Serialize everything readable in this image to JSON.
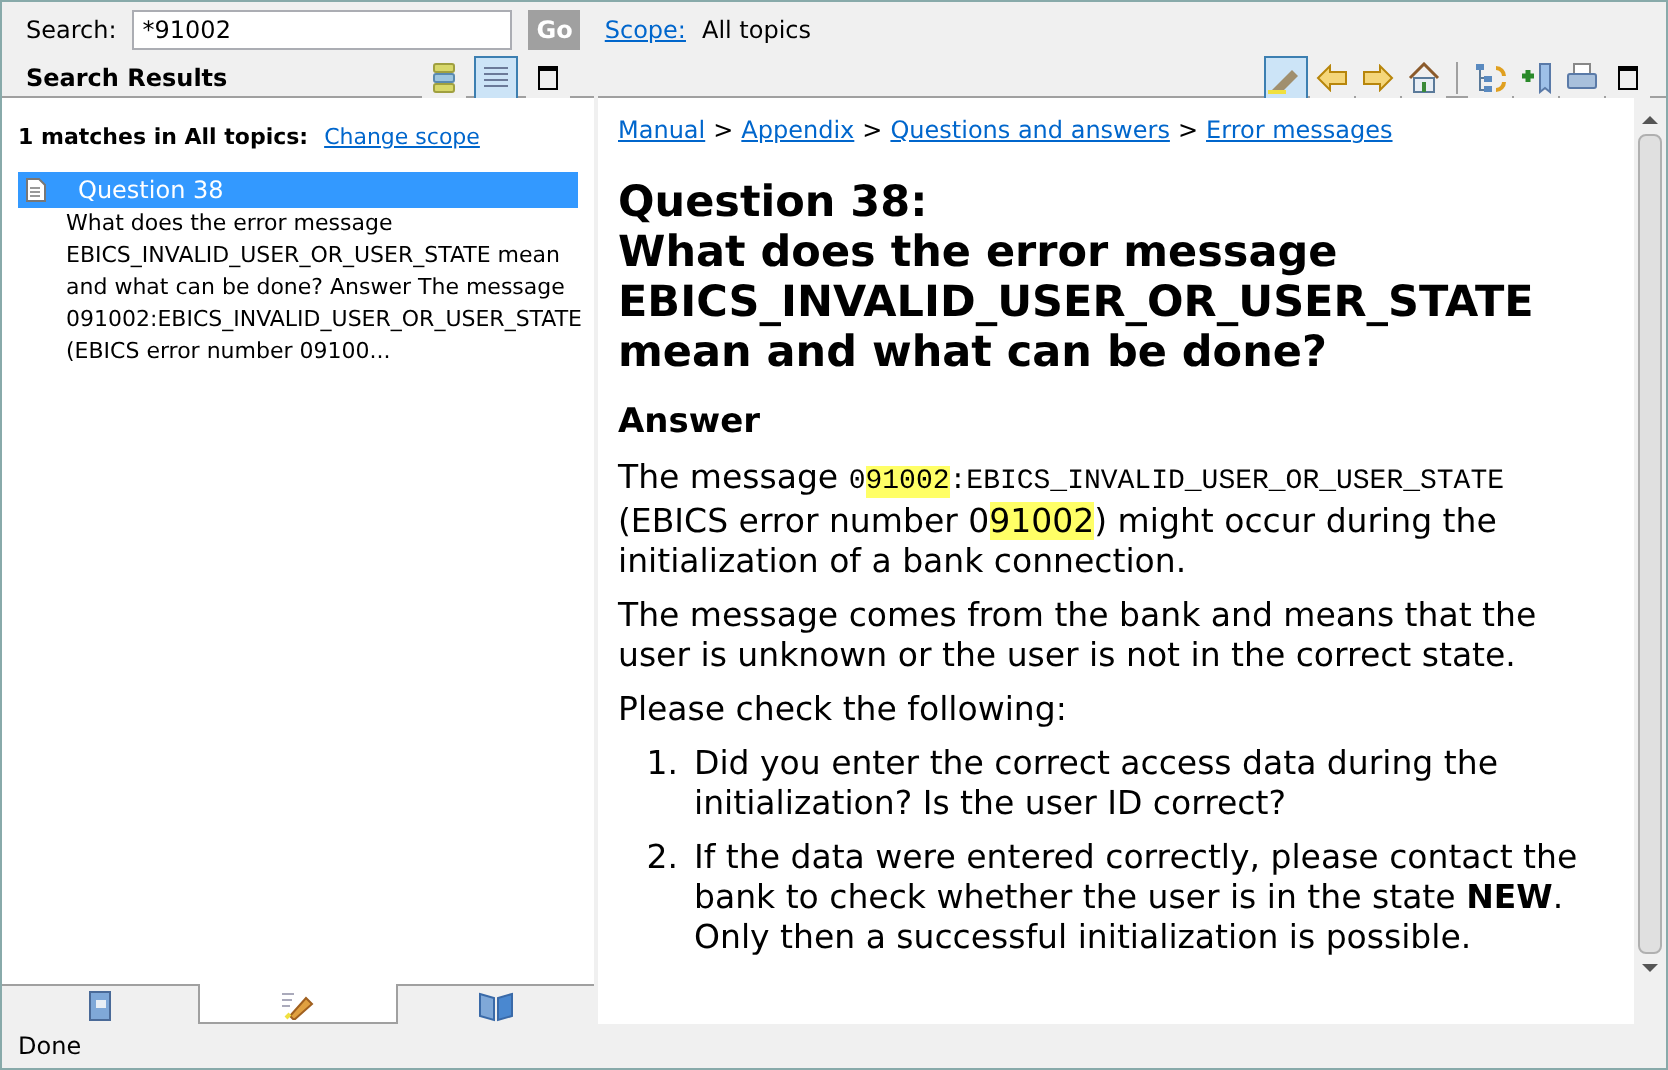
{
  "search": {
    "label": "Search:",
    "value": "*91002",
    "go": "Go",
    "scope_link": "Scope:",
    "scope_value": "All topics"
  },
  "left_pane": {
    "title": "Search Results",
    "toolbar": [
      {
        "kind": "group",
        "selected": false
      },
      {
        "kind": "flat",
        "selected": true
      },
      {
        "kind": "maximize",
        "selected": false
      }
    ],
    "summary": "1 matches in All topics:",
    "change_scope": "Change scope",
    "results": [
      {
        "title": "Question 38",
        "selected": true,
        "snippet": "What does the error message EBICS_INVALID_USER_OR_USER_STATE mean and what can be done? Answer The message 091002:EBICS_INVALID_USER_OR_USER_STATE (EBICS error number 09100..."
      }
    ],
    "tabs": [
      {
        "kind": "contents",
        "selected": false
      },
      {
        "kind": "search",
        "selected": true
      },
      {
        "kind": "index",
        "selected": false
      }
    ]
  },
  "right_pane": {
    "toolbar": [
      {
        "kind": "highlight",
        "selected": true
      },
      {
        "kind": "back",
        "selected": false
      },
      {
        "kind": "forward",
        "selected": false
      },
      {
        "kind": "home",
        "selected": false
      },
      {
        "kind": "separator"
      },
      {
        "kind": "sync",
        "selected": false
      },
      {
        "kind": "bookmark",
        "selected": false
      },
      {
        "kind": "print",
        "selected": false
      },
      {
        "kind": "maximize",
        "selected": false
      }
    ],
    "breadcrumb": [
      "Manual",
      "Appendix",
      "Questions and answers",
      "Error messages"
    ],
    "breadcrumb_separator": ">",
    "title_lines": [
      "Question 38:",
      "What does the error message EBICS_INVALID_USER_OR_USER_STATE mean and what can be done?"
    ],
    "section": "Answer",
    "paragraphs": [
      [
        {
          "kind": "text",
          "text": "The message "
        },
        {
          "kind": "code",
          "text": "0"
        },
        {
          "kind": "code_highlight",
          "text": "91002"
        },
        {
          "kind": "code",
          "text": ":EBICS_INVALID_USER_OR_USER_STATE"
        },
        {
          "kind": "text",
          "text": " (EBICS error number 0"
        },
        {
          "kind": "highlight",
          "text": "91002"
        },
        {
          "kind": "text",
          "text": ") might occur during the initialization of a bank connection."
        }
      ],
      [
        {
          "kind": "text",
          "text": "The message comes from the bank and means that the user is unknown or the user is not in the correct state."
        }
      ],
      [
        {
          "kind": "text",
          "text": "Please check the following:"
        }
      ]
    ],
    "list": [
      {
        "number": "1.",
        "text": "Did you enter the correct access data during the initialization? Is the user ID correct?"
      },
      {
        "number": "2.",
        "text": "If the data were entered correctly, please contact the bank to check whether the user is in the state **NEW**. Only then a successful initialization is possible."
      }
    ]
  },
  "status_bar": "Done"
}
